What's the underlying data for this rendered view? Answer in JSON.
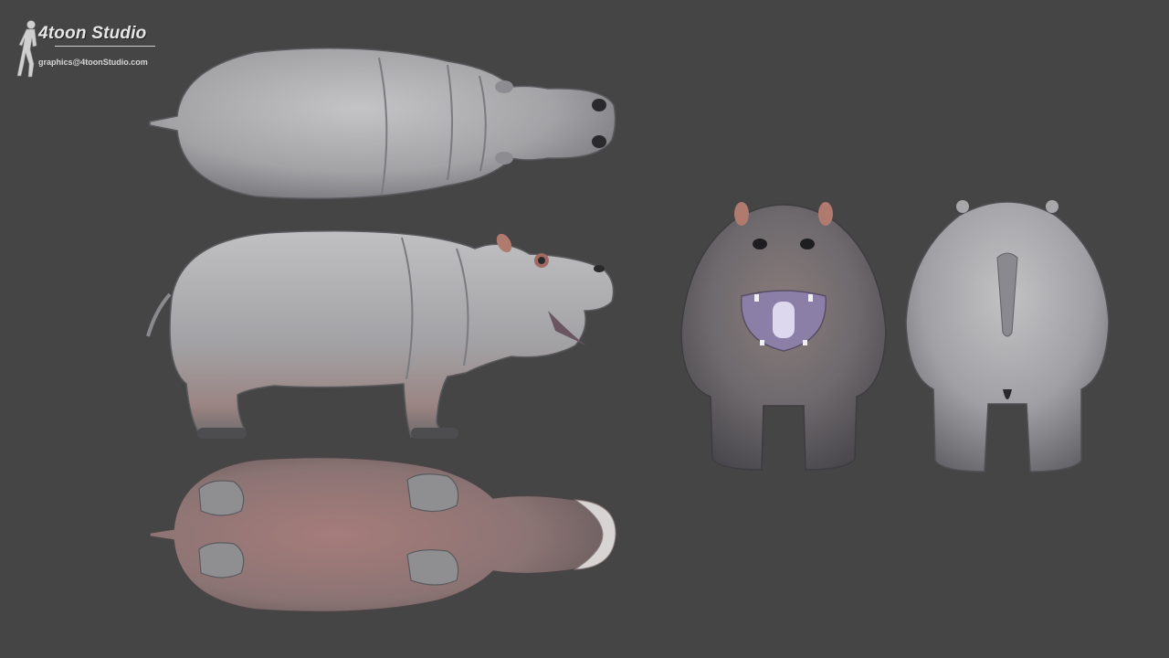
{
  "logo": {
    "title": "4toon Studio",
    "email": "graphics@4toonStudio.com"
  },
  "colors": {
    "background": "#454545",
    "hippo_skin": "#a3a3a6",
    "hippo_skin_light": "#c4c4c6",
    "hippo_skin_dark": "#6e6e72",
    "belly_pink": "#9a7e7a",
    "mouth_purple": "#8b7fa8",
    "ear_pink": "#b07a6e"
  },
  "views": [
    "top-view",
    "side-view",
    "bottom-view",
    "front-view",
    "back-view"
  ]
}
